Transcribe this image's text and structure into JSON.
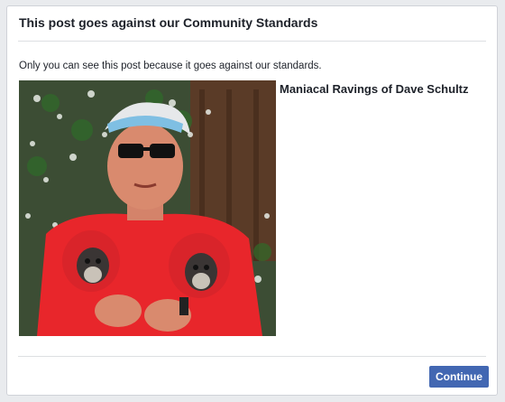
{
  "dialog": {
    "title": "This post goes against our Community Standards",
    "notice": "Only you can see this post because it goes against our standards."
  },
  "post": {
    "author": "Maniacal Ravings of Dave Schultz",
    "image": "photo-of-man-holding-two-dogs"
  },
  "footer": {
    "continue_label": "Continue"
  },
  "colors": {
    "button_bg": "#4267b2",
    "background": "#e9ebee",
    "divider": "#dddfe2",
    "text": "#1d2129"
  }
}
